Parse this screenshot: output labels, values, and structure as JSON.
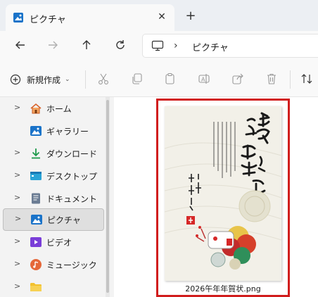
{
  "window": {
    "tab_title": "ピクチャ",
    "tab_close": "✕",
    "new_tab": "+"
  },
  "address_bar": {
    "separator": "›",
    "location": "ピクチャ"
  },
  "command_bar": {
    "new_label": "新規作成",
    "new_dropdown": "⌄"
  },
  "sidebar": {
    "items": [
      {
        "label": "ホーム",
        "icon": "home-icon",
        "expandable": true
      },
      {
        "label": "ギャラリー",
        "icon": "gallery-icon",
        "expandable": false
      },
      {
        "label": "ダウンロード",
        "icon": "download-icon",
        "expandable": true
      },
      {
        "label": "デスクトップ",
        "icon": "desktop-icon",
        "expandable": true
      },
      {
        "label": "ドキュメント",
        "icon": "document-icon",
        "expandable": true
      },
      {
        "label": "ピクチャ",
        "icon": "pictures-icon",
        "expandable": true,
        "selected": true
      },
      {
        "label": "ビデオ",
        "icon": "video-icon",
        "expandable": true
      },
      {
        "label": "ミュージック",
        "icon": "music-icon",
        "expandable": true
      },
      {
        "label": "",
        "icon": "folder-icon",
        "expandable": true
      }
    ]
  },
  "content": {
    "files": [
      {
        "name": "2026午年年賀状.png",
        "highlight_color": "#d11d1d"
      }
    ]
  },
  "colors": {
    "accent": "#0067c0",
    "selection_bg": "#dfdfdf",
    "highlight_border": "#d11d1d"
  }
}
